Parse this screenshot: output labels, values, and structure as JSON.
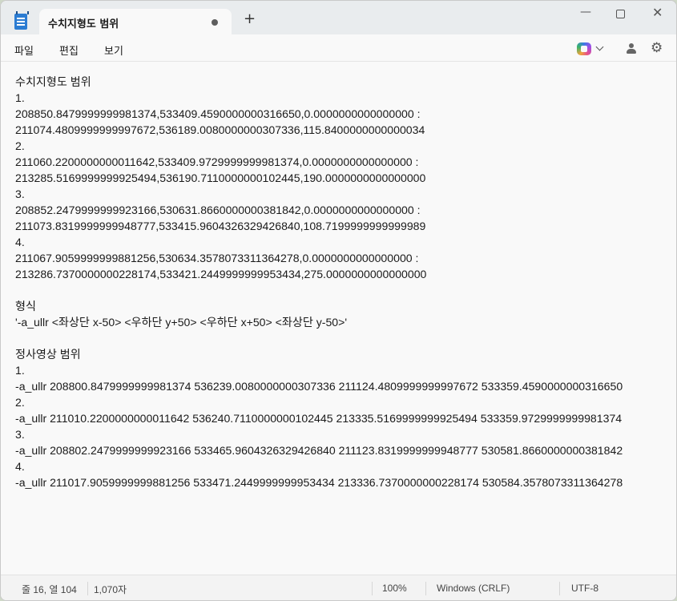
{
  "titlebar": {
    "tab_title": "수치지형도 범위",
    "new_tab_label": "+",
    "minimize_label": "—",
    "close_label": "✕"
  },
  "menu": {
    "file": "파일",
    "edit": "편집",
    "view": "보기"
  },
  "icons": {
    "gear_glyph": "⚙"
  },
  "document": {
    "lines": [
      "수치지형도 범위",
      "1.",
      "208850.8479999999981374,533409.4590000000316650,0.0000000000000000 :",
      "211074.4809999999997672,536189.0080000000307336,115.8400000000000034",
      "2.",
      "211060.2200000000011642,533409.9729999999981374,0.0000000000000000 :",
      "213285.5169999999925494,536190.7110000000102445,190.0000000000000000",
      "3.",
      "208852.2479999999923166,530631.8660000000381842,0.0000000000000000 :",
      "211073.8319999999948777,533415.9604326329426840,108.7199999999999989",
      "4.",
      "211067.9059999999881256,530634.3578073311364278,0.0000000000000000 :",
      "213286.7370000000228174,533421.2449999999953434,275.0000000000000000",
      "",
      "형식",
      "'-a_ullr <좌상단 x-50> <우하단 y+50> <우하단 x+50> <좌상단 y-50>'",
      "",
      "정사영상 범위",
      "1.",
      "-a_ullr 208800.8479999999981374 536239.0080000000307336 211124.4809999999997672 533359.4590000000316650",
      "2.",
      "-a_ullr 211010.2200000000011642 536240.7110000000102445 213335.5169999999925494 533359.9729999999981374",
      "3.",
      "-a_ullr 208802.2479999999923166 533465.9604326329426840 211123.8319999999948777 530581.8660000000381842",
      "4.",
      "-a_ullr 211017.9059999999881256 533471.2449999999953434 213336.7370000000228174 530584.3578073311364278"
    ]
  },
  "status": {
    "position": "줄 16, 열 104",
    "char_count": "1,070자",
    "zoom": "100%",
    "line_ending": "Windows (CRLF)",
    "encoding": "UTF-8"
  }
}
